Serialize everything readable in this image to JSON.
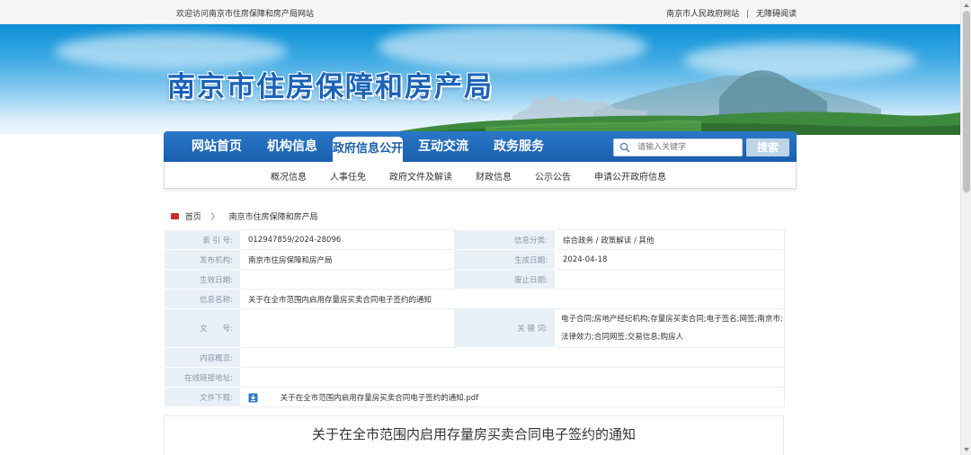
{
  "topbar": {
    "welcome": "欢迎访问南京市住房保障和房产局网站",
    "gov_link": "南京市人民政府网站",
    "separator": "|",
    "accessibility_link": "无障碍阅读"
  },
  "banner": {
    "site_title": "南京市住房保障和房产局"
  },
  "nav": {
    "items": [
      "网站首页",
      "机构信息",
      "政府信息公开",
      "互动交流",
      "政务服务"
    ],
    "active_index": 2,
    "search_placeholder": "请输入关键字",
    "search_button": "搜索"
  },
  "subnav": {
    "items": [
      "概况信息",
      "人事任免",
      "政府文件及解读",
      "财政信息",
      "公示公告",
      "申请公开政府信息"
    ]
  },
  "breadcrumb": {
    "home": "首页",
    "arrow": "〉",
    "current": "南京市住房保障和房产局"
  },
  "info": {
    "index_label": "索 引 号:",
    "index_value": "012947859/2024-28096",
    "category_label": "信息分类:",
    "category_value": "综合政务 / 政策解读 / 其他",
    "publisher_label": "发布机构:",
    "publisher_value": "南京市住房保障和房产局",
    "generated_label": "生成日期:",
    "generated_value": "2024-04-18",
    "effective_label": "生效日期:",
    "effective_value": "",
    "expired_label": "废止日期:",
    "expired_value": "",
    "name_label": "信息名称:",
    "name_value": "关于在全市范围内启用存量房买卖合同电子签约的通知",
    "docno_label": "文　　号:",
    "docno_value": "",
    "keywords_label": "关 键 词:",
    "keywords_value": "电子合同;房地产经纪机构;存量房买卖合同;电子签名;网签;南京市;法律效力;合同网签;交易信息;购房人",
    "overview_label": "内容概览:",
    "overview_value": "",
    "online_label": "在线链接地址:",
    "online_value": "",
    "download_label": "文件下载:",
    "download_value": "关于在全市范围内启用存量房买卖合同电子签约的通知.pdf"
  },
  "article": {
    "title": "关于在全市范围内启用存量房买卖合同电子签约的通知"
  },
  "colors": {
    "nav_blue": "#1a5fae",
    "title_blue": "#1b63b8",
    "label_bg": "#e9f0f7"
  }
}
